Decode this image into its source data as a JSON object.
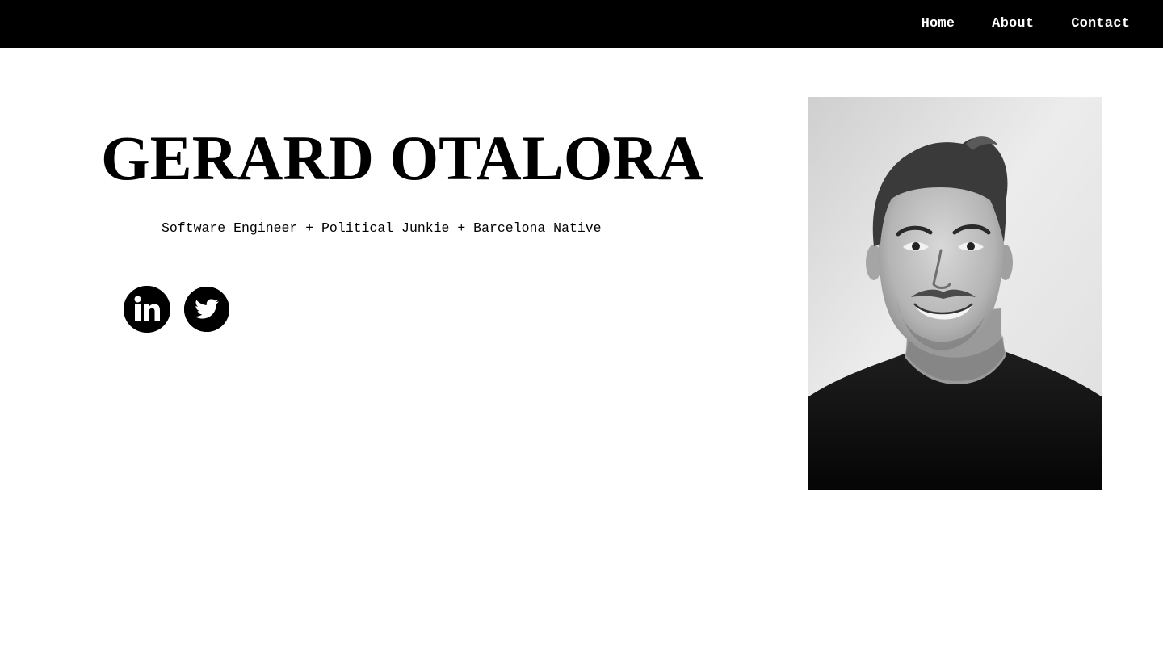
{
  "nav": {
    "items": [
      {
        "label": "Home"
      },
      {
        "label": "About"
      },
      {
        "label": "Contact"
      }
    ]
  },
  "hero": {
    "name": "GERARD OTALORA",
    "tagline": "Software Engineer + Political Junkie + Barcelona Native"
  },
  "social": {
    "links": [
      {
        "icon": "linkedin-icon",
        "glyph": "in"
      },
      {
        "icon": "twitter-icon"
      }
    ]
  },
  "colors": {
    "topbar": "#000000",
    "background": "#ffffff",
    "text": "#000000",
    "nav_text": "#ffffff"
  },
  "portrait": {
    "style": "black-and-white photo"
  }
}
